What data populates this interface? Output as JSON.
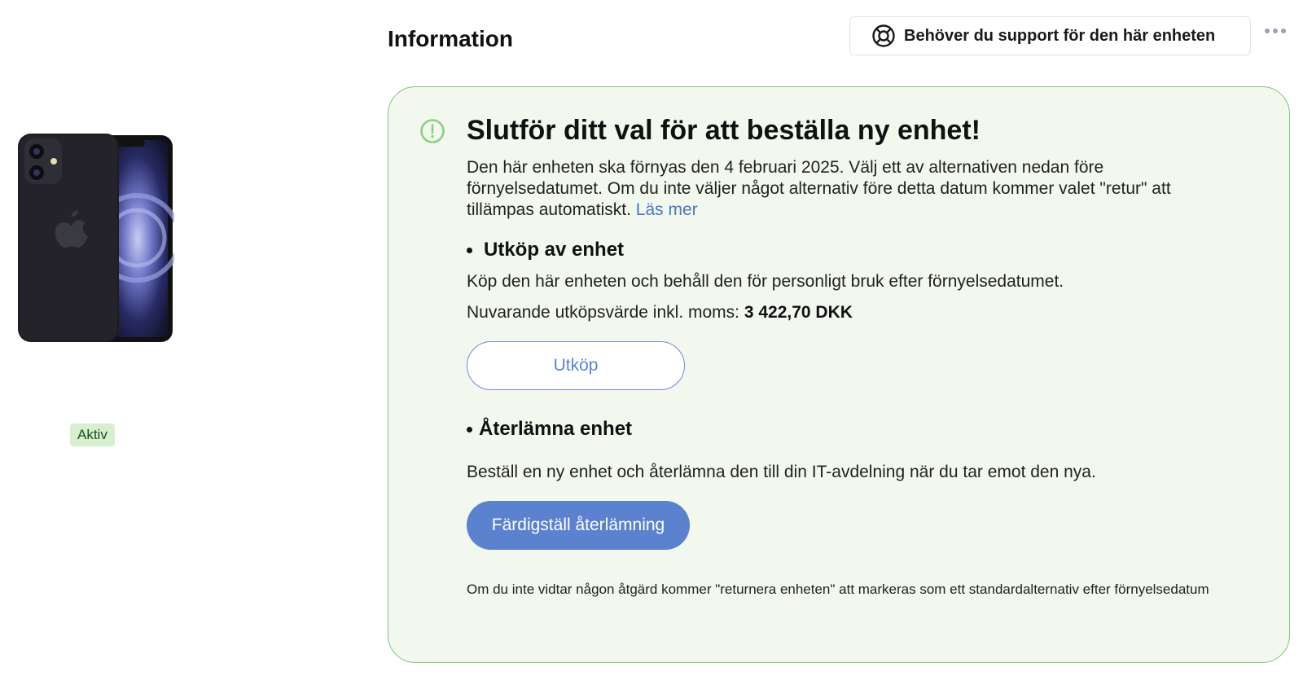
{
  "device": {
    "status_label": "Aktiv"
  },
  "header": {
    "title": "Information",
    "support_button_label": "Behöver du support för den här enheten"
  },
  "notice": {
    "title": "Slutför ditt val för att beställa ny enhet!",
    "description": "Den här enheten ska förnyas den 4 februari 2025. Välj ett av alternativen nedan före förnyelsedatumet. Om du inte väljer något alternativ före detta datum kommer valet \"retur\" att tillämpas automatiskt.",
    "read_more_link": "Läs mer",
    "buyout": {
      "heading": "Utköp av enhet",
      "description": "Köp den här enheten och behåll den för personligt bruk efter förnyelsedatumet.",
      "value_label": "Nuvarande utköpsvärde inkl. moms:",
      "value": "3 422,70 DKK",
      "button_label": "Utköp"
    },
    "return": {
      "heading": "Återlämna enhet",
      "description": "Beställ en ny enhet och återlämna den till din IT-avdelning när du tar emot den nya.",
      "button_label": "Färdigställ återlämning"
    },
    "footnote": "Om du inte vidtar någon åtgärd kommer \"returnera enheten\" att markeras som ett standardalternativ efter förnyelsedatum"
  },
  "colors": {
    "card_background": "#f2f8ee",
    "card_border": "#7fc47a",
    "accent_blue": "#5b82cf",
    "badge_background": "#d6f0cf"
  }
}
